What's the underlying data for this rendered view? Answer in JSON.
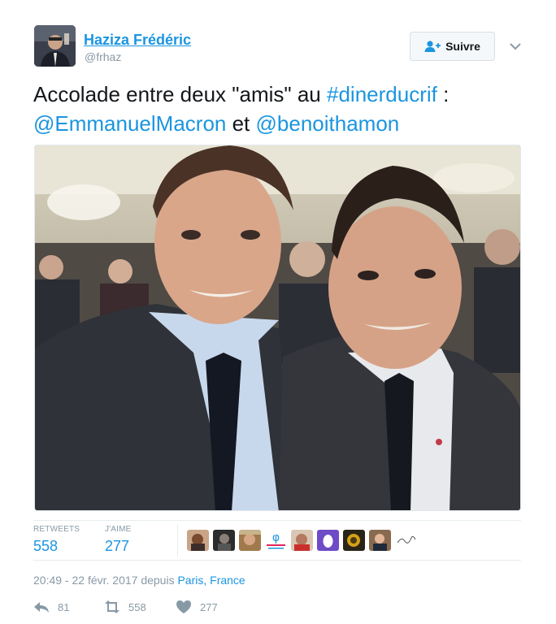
{
  "author": {
    "name": "Haziza Frédéric",
    "handle": "@frhaz"
  },
  "follow_button": {
    "label": "Suivre"
  },
  "tweet": {
    "line1_plain": "Accolade entre deux \"amis\" au ",
    "hashtag": "#dinerducrif",
    "line1_tail": " :",
    "mention1": "@EmmanuelMacron",
    "connector": " et ",
    "mention2": "@benoithamon"
  },
  "stats": {
    "retweets_label": "RETWEETS",
    "retweets_value": "558",
    "likes_label": "J'AIME",
    "likes_value": "277"
  },
  "liker_avatars_count": 9,
  "meta": {
    "time_date": "20:49 - 22 févr. 2017 depuis ",
    "place": "Paris, France"
  },
  "actions": {
    "reply_count": "81",
    "retweet_count": "558",
    "like_count": "277"
  },
  "colors": {
    "link": "#1b95e0",
    "muted": "#8899a6",
    "text": "#14171a",
    "border": "#e6ecf0"
  }
}
